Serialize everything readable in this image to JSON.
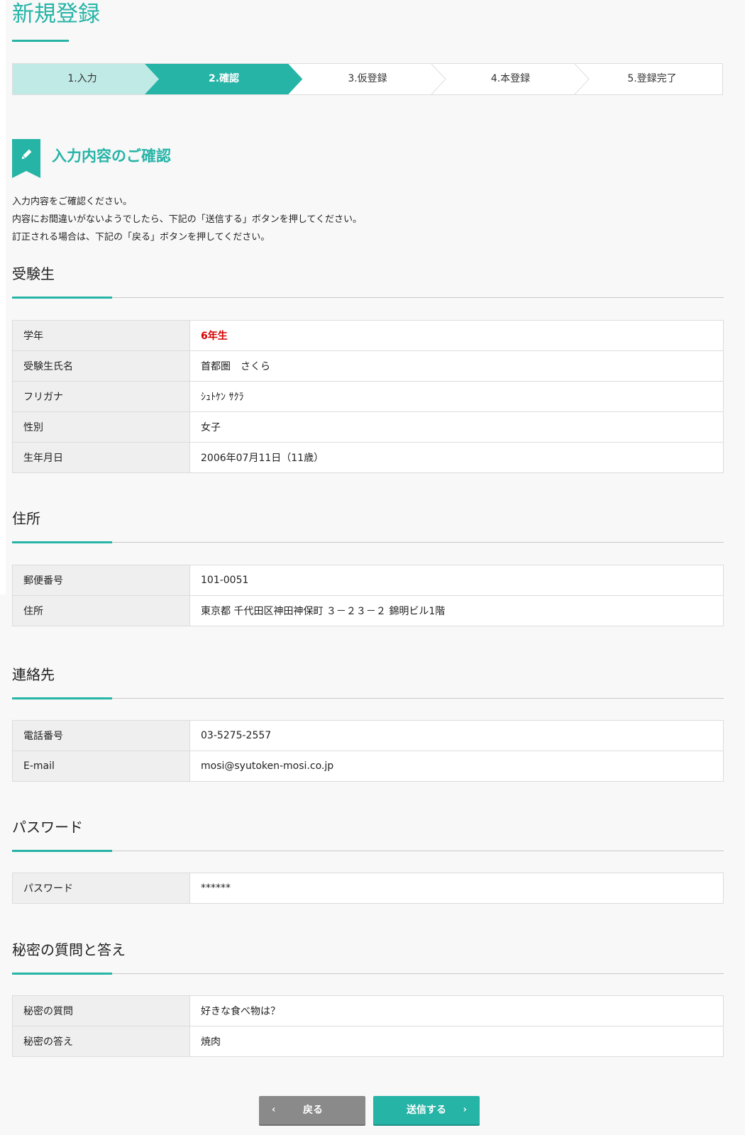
{
  "page": {
    "title": "新規登録"
  },
  "colors": {
    "accent": "#26b4a7",
    "accent_light": "#bfeae6",
    "highlight_red": "#d40000"
  },
  "steps": [
    {
      "label": "1.入力",
      "state": "done"
    },
    {
      "label": "2.確認",
      "state": "active"
    },
    {
      "label": "3.仮登録",
      "state": "pending"
    },
    {
      "label": "4.本登録",
      "state": "pending"
    },
    {
      "label": "5.登録完了",
      "state": "pending"
    }
  ],
  "confirm": {
    "icon": "pencil-icon",
    "heading": "入力内容のご確認",
    "intro": [
      "入力内容をご確認ください。",
      "内容にお間違いがないようでしたら、下記の「送信する」ボタンを押してください。",
      "訂正される場合は、下記の「戻る」ボタンを押してください。"
    ]
  },
  "sections": {
    "student": {
      "title": "受験生",
      "rows": [
        {
          "label": "学年",
          "value": "6年生"
        },
        {
          "label": "受験生氏名",
          "value": "首都圏　さくら"
        },
        {
          "label": "フリガナ",
          "value": "ｼｭﾄｹﾝ ｻｸﾗ"
        },
        {
          "label": "性別",
          "value": "女子"
        },
        {
          "label": "生年月日",
          "value": "2006年07月11日（11歳）"
        }
      ]
    },
    "address": {
      "title": "住所",
      "rows": [
        {
          "label": "郵便番号",
          "value": "101-0051"
        },
        {
          "label": "住所",
          "value": "東京都 千代田区神田神保町 ３－２３－２ 錦明ビル1階"
        }
      ]
    },
    "contact": {
      "title": "連絡先",
      "rows": [
        {
          "label": "電話番号",
          "value": "03-5275-2557"
        },
        {
          "label": "E-mail",
          "value": "mosi@syutoken-mosi.co.jp"
        }
      ]
    },
    "password": {
      "title": "パスワード",
      "rows": [
        {
          "label": "パスワード",
          "value": "******"
        }
      ]
    },
    "secret": {
      "title": "秘密の質問と答え",
      "rows": [
        {
          "label": "秘密の質問",
          "value": "好きな食べ物は？"
        },
        {
          "label": "秘密の答え",
          "value": "焼肉"
        }
      ]
    }
  },
  "buttons": {
    "back": {
      "label": "戻る",
      "icon": "chevron-left-icon"
    },
    "send": {
      "label": "送信する",
      "icon": "chevron-right-icon"
    }
  }
}
